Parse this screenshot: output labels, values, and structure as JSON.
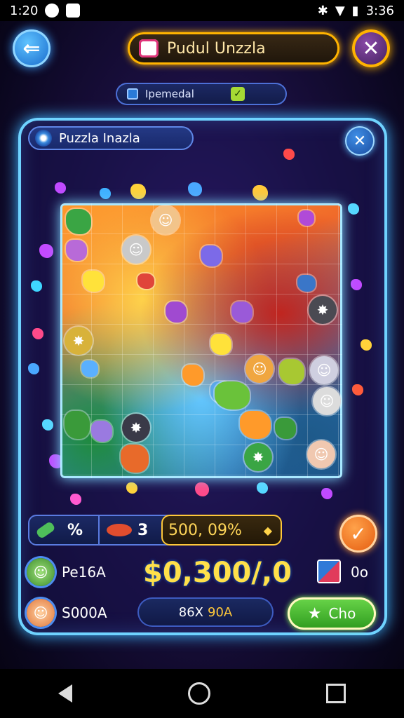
{
  "status_bar": {
    "time": "1:20",
    "right_time": "3:36"
  },
  "header": {
    "title": "Pudul Unzzla",
    "back_icon": "back-arrow-icon",
    "close_icon": "close-icon"
  },
  "subheader": {
    "label": "Ipemedal"
  },
  "panel": {
    "title": "Puzzla Inazla"
  },
  "stats": {
    "tool_symbol": "%",
    "fish_count": "3",
    "progress": "500, 09%"
  },
  "players": [
    {
      "name": "Pe16A",
      "avatar_icon": "player-avatar-icon"
    },
    {
      "name": "S000A",
      "avatar_icon": "player-avatar-icon"
    }
  ],
  "score": "$0,300/,0",
  "side_action": {
    "label": "0o"
  },
  "timer_pill": {
    "left": "86X",
    "right": "90A"
  },
  "go_button": {
    "label": "Cho"
  },
  "colors": {
    "accent_blue": "#6fd3ff",
    "gold": "#ffc83a",
    "green": "#4fbf3a",
    "orange": "#ff8a1a"
  }
}
